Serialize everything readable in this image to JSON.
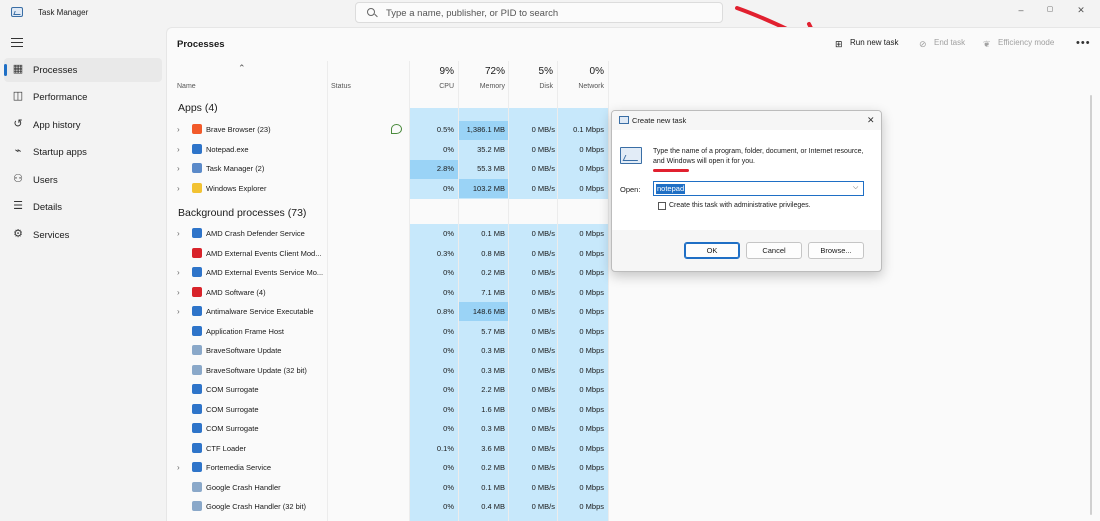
{
  "window": {
    "title": "Task Manager",
    "minimize": "–",
    "maximize": "▢",
    "close": "✕"
  },
  "search": {
    "placeholder": "Type a name, publisher, or PID to search"
  },
  "sidebar": {
    "items": [
      {
        "label": "Processes",
        "icon": "processes-icon",
        "active": true
      },
      {
        "label": "Performance",
        "icon": "performance-icon"
      },
      {
        "label": "App history",
        "icon": "app-history-icon"
      },
      {
        "label": "Startup apps",
        "icon": "startup-icon"
      },
      {
        "label": "Users",
        "icon": "users-icon"
      },
      {
        "label": "Details",
        "icon": "details-icon"
      },
      {
        "label": "Services",
        "icon": "services-icon"
      }
    ]
  },
  "toolbar": {
    "title": "Processes",
    "run_new_task": "Run new task",
    "end_task": "End task",
    "efficiency_mode": "Efficiency mode",
    "more": "•••"
  },
  "columns": {
    "name": "Name",
    "status": "Status",
    "cpu": {
      "pct": "9%",
      "label": "CPU"
    },
    "memory": {
      "pct": "72%",
      "label": "Memory"
    },
    "disk": {
      "pct": "5%",
      "label": "Disk"
    },
    "network": {
      "pct": "0%",
      "label": "Network"
    }
  },
  "apps": {
    "title": "Apps (4)",
    "rows": [
      {
        "name": "Brave Browser (23)",
        "cpu": "0.5%",
        "mem": "1,386.1 MB",
        "disk": "0 MB/s",
        "net": "0.1 Mbps",
        "expand": true,
        "eco": true,
        "color": "#f25a2a"
      },
      {
        "name": "Notepad.exe",
        "cpu": "0%",
        "mem": "35.2 MB",
        "disk": "0 MB/s",
        "net": "0 Mbps",
        "expand": true,
        "color": "#2e74c9"
      },
      {
        "name": "Task Manager (2)",
        "cpu": "2.8%",
        "mem": "55.3 MB",
        "disk": "0 MB/s",
        "net": "0 Mbps",
        "expand": true,
        "color": "#5b8ac9"
      },
      {
        "name": "Windows Explorer",
        "cpu": "0%",
        "mem": "103.2 MB",
        "disk": "0 MB/s",
        "net": "0 Mbps",
        "expand": true,
        "color": "#f2c232"
      }
    ]
  },
  "background": {
    "title": "Background processes (73)",
    "rows": [
      {
        "name": "AMD Crash Defender Service",
        "cpu": "0%",
        "mem": "0.1 MB",
        "disk": "0 MB/s",
        "net": "0 Mbps",
        "expand": true,
        "color": "#2e74c9"
      },
      {
        "name": "AMD External Events Client Mod...",
        "cpu": "0.3%",
        "mem": "0.8 MB",
        "disk": "0 MB/s",
        "net": "0 Mbps",
        "expand": false,
        "color": "#d8232a"
      },
      {
        "name": "AMD External Events Service Mo...",
        "cpu": "0%",
        "mem": "0.2 MB",
        "disk": "0 MB/s",
        "net": "0 Mbps",
        "expand": true,
        "color": "#2e74c9"
      },
      {
        "name": "AMD Software (4)",
        "cpu": "0%",
        "mem": "7.1 MB",
        "disk": "0 MB/s",
        "net": "0 Mbps",
        "expand": true,
        "color": "#d8232a"
      },
      {
        "name": "Antimalware Service Executable",
        "cpu": "0.8%",
        "mem": "148.6 MB",
        "disk": "0 MB/s",
        "net": "0 Mbps",
        "expand": true,
        "color": "#2e74c9"
      },
      {
        "name": "Application Frame Host",
        "cpu": "0%",
        "mem": "5.7 MB",
        "disk": "0 MB/s",
        "net": "0 Mbps",
        "expand": false,
        "color": "#2e74c9"
      },
      {
        "name": "BraveSoftware Update",
        "cpu": "0%",
        "mem": "0.3 MB",
        "disk": "0 MB/s",
        "net": "0 Mbps",
        "expand": false,
        "color": "#8aa8c9"
      },
      {
        "name": "BraveSoftware Update (32 bit)",
        "cpu": "0%",
        "mem": "0.3 MB",
        "disk": "0 MB/s",
        "net": "0 Mbps",
        "expand": false,
        "color": "#8aa8c9"
      },
      {
        "name": "COM Surrogate",
        "cpu": "0%",
        "mem": "2.2 MB",
        "disk": "0 MB/s",
        "net": "0 Mbps",
        "expand": false,
        "color": "#2e74c9"
      },
      {
        "name": "COM Surrogate",
        "cpu": "0%",
        "mem": "1.6 MB",
        "disk": "0 MB/s",
        "net": "0 Mbps",
        "expand": false,
        "color": "#2e74c9"
      },
      {
        "name": "COM Surrogate",
        "cpu": "0%",
        "mem": "0.3 MB",
        "disk": "0 MB/s",
        "net": "0 Mbps",
        "expand": false,
        "color": "#2e74c9"
      },
      {
        "name": "CTF Loader",
        "cpu": "0.1%",
        "mem": "3.6 MB",
        "disk": "0 MB/s",
        "net": "0 Mbps",
        "expand": false,
        "color": "#2e74c9"
      },
      {
        "name": "Fortemedia Service",
        "cpu": "0%",
        "mem": "0.2 MB",
        "disk": "0 MB/s",
        "net": "0 Mbps",
        "expand": true,
        "color": "#2e74c9"
      },
      {
        "name": "Google Crash Handler",
        "cpu": "0%",
        "mem": "0.1 MB",
        "disk": "0 MB/s",
        "net": "0 Mbps",
        "expand": false,
        "color": "#8aa8c9"
      },
      {
        "name": "Google Crash Handler (32 bit)",
        "cpu": "0%",
        "mem": "0.4 MB",
        "disk": "0 MB/s",
        "net": "0 Mbps",
        "expand": false,
        "color": "#8aa8c9"
      }
    ]
  },
  "dialog": {
    "title": "Create new task",
    "close": "✕",
    "description": "Type the name of a program, folder, document, or Internet resource, and Windows will open it for you.",
    "open_label": "Open:",
    "open_value": "notepad",
    "admin_checkbox": "Create this task with administrative privileges.",
    "ok": "OK",
    "cancel": "Cancel",
    "browse": "Browse..."
  },
  "colors": {
    "accent": "#1f6fc5",
    "heat_light": "#c7e8fb",
    "heat_strong": "#9ad3f6",
    "annotation": "#e1202f"
  }
}
